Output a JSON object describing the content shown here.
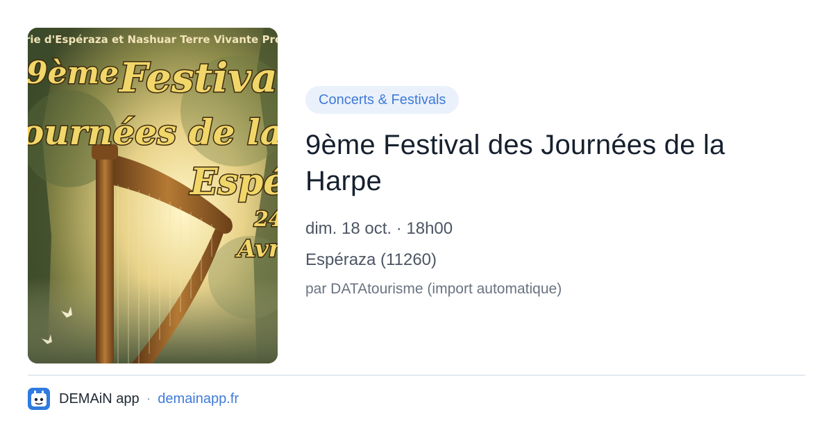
{
  "poster": {
    "top_line": "rie d'Espéraza et Nashuar Terre Vivante Prés",
    "line1": "9ème",
    "line1b": "Festival",
    "line2": "ournées de la h",
    "line3": "Espér",
    "line4": "24",
    "line5": "Avr"
  },
  "event": {
    "category": "Concerts & Festivals",
    "title": "9ème Festival des Journées de la Harpe",
    "datetime": "dim. 18 oct. · 18h00",
    "location": "Espéraza (11260)",
    "source": "par DATAtourisme (import automatique)"
  },
  "footer": {
    "app_name": "DEMAiN app",
    "separator": "·",
    "url": "demainapp.fr"
  },
  "colors": {
    "accent": "#3f7ad8",
    "tag_bg": "#eaf1fb",
    "title": "#16202e"
  },
  "icons": {
    "app": "demain-app-icon"
  }
}
